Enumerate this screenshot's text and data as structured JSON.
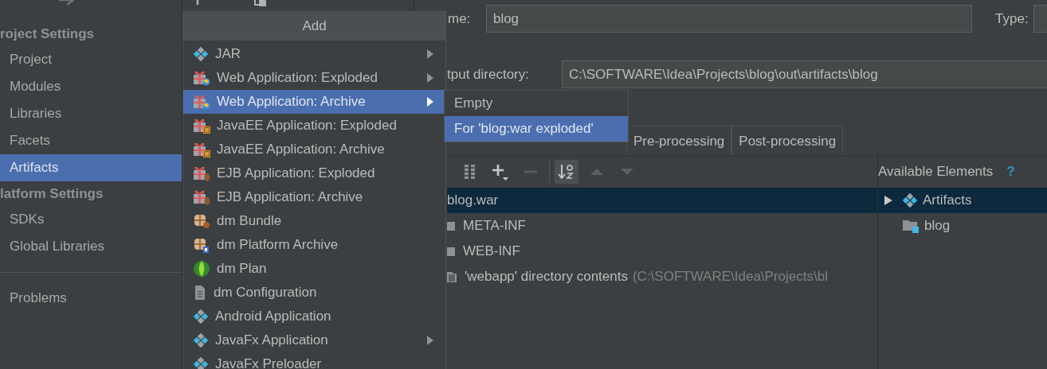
{
  "sidebar": {
    "sections": [
      {
        "heading": "roject Settings",
        "items": [
          {
            "label": "Project",
            "selected": false
          },
          {
            "label": "Modules",
            "selected": false
          },
          {
            "label": "Libraries",
            "selected": false
          },
          {
            "label": "Facets",
            "selected": false
          },
          {
            "label": "Artifacts",
            "selected": true
          }
        ]
      },
      {
        "heading": "latform Settings",
        "items": [
          {
            "label": "SDKs",
            "selected": false
          },
          {
            "label": "Global Libraries",
            "selected": false
          }
        ]
      }
    ],
    "extra_items": [
      {
        "label": "Problems",
        "selected": false
      }
    ]
  },
  "add_menu": {
    "title": "Add",
    "items": [
      {
        "label": "JAR",
        "kind": "jar",
        "has_submenu": true,
        "selected": false
      },
      {
        "label": "Web Application: Exploded",
        "kind": "web",
        "has_submenu": true,
        "selected": false
      },
      {
        "label": "Web Application: Archive",
        "kind": "web",
        "has_submenu": true,
        "selected": true
      },
      {
        "label": "JavaEE Application: Exploded",
        "kind": "javaee",
        "has_submenu": false,
        "selected": false
      },
      {
        "label": "JavaEE Application: Archive",
        "kind": "javaee",
        "has_submenu": false,
        "selected": false
      },
      {
        "label": "EJB Application: Exploded",
        "kind": "ejb",
        "has_submenu": false,
        "selected": false
      },
      {
        "label": "EJB Application: Archive",
        "kind": "ejb",
        "has_submenu": false,
        "selected": false
      },
      {
        "label": "dm Bundle",
        "kind": "bundle",
        "has_submenu": false,
        "selected": false
      },
      {
        "label": "dm Platform Archive",
        "kind": "platform",
        "has_submenu": false,
        "selected": false
      },
      {
        "label": "dm Plan",
        "kind": "plan",
        "has_submenu": false,
        "selected": false
      },
      {
        "label": "dm Configuration",
        "kind": "config",
        "has_submenu": false,
        "selected": false
      },
      {
        "label": "Android Application",
        "kind": "jar",
        "has_submenu": false,
        "selected": false
      },
      {
        "label": "JavaFx Application",
        "kind": "jar",
        "has_submenu": true,
        "selected": false
      },
      {
        "label": "JavaFx Preloader",
        "kind": "jar",
        "has_submenu": false,
        "selected": false
      }
    ]
  },
  "submenu": {
    "items": [
      {
        "label": "Empty",
        "selected": false
      },
      {
        "label": "For 'blog:war exploded'",
        "selected": true
      }
    ]
  },
  "artifact_form": {
    "name_label": "me:",
    "name_value": "blog",
    "type_label": "Type:",
    "output_label": "tput directory:",
    "output_value": "C:\\SOFTWARE\\Idea\\Projects\\blog\\out\\artifacts\\blog"
  },
  "tabs": [
    {
      "label": "Pre-processing",
      "selected": false
    },
    {
      "label": "Post-processing",
      "selected": false
    }
  ],
  "layout_tree": {
    "rows": [
      {
        "label": "blog.war",
        "selected": true,
        "children": [
          {
            "label": "META-INF",
            "kind": "folder",
            "selected": false
          },
          {
            "label": "WEB-INF",
            "kind": "folder",
            "selected": false
          },
          {
            "label": "'webapp' directory contents",
            "note": "(C:\\SOFTWARE\\Idea\\Projects\\bl",
            "kind": "contents",
            "selected": false
          }
        ]
      }
    ]
  },
  "available": {
    "title": "Available Elements",
    "help": "?",
    "items": [
      {
        "label": "Artifacts",
        "kind": "group",
        "expanded": false,
        "selected": true
      },
      {
        "label": "blog",
        "kind": "module",
        "selected": false
      }
    ]
  }
}
